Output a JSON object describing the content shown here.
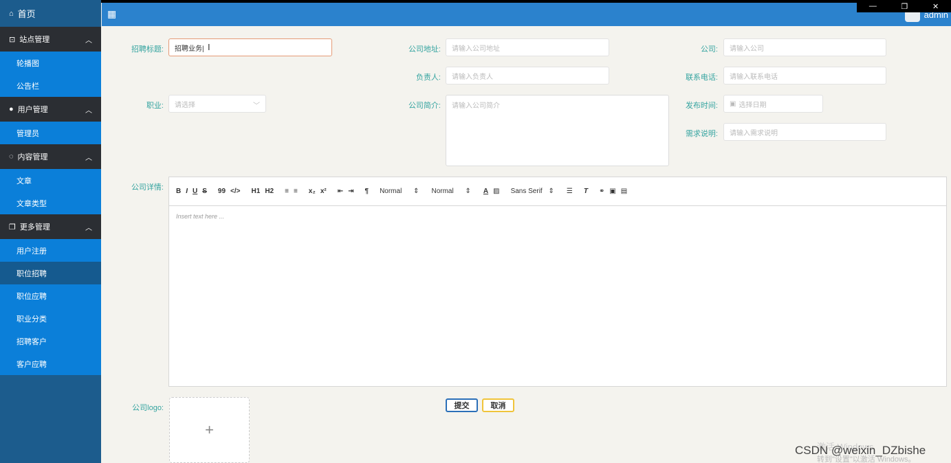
{
  "sidebar": {
    "home": "首页",
    "groups": [
      {
        "label": "站点管理",
        "items": [
          "轮播图",
          "公告栏"
        ]
      },
      {
        "label": "用户管理",
        "items": [
          "管理员"
        ]
      },
      {
        "label": "内容管理",
        "items": [
          "文章",
          "文章类型"
        ]
      },
      {
        "label": "更多管理",
        "items": [
          "用户注册",
          "职位招聘",
          "职位应聘",
          "职业分类",
          "招聘客户",
          "客户应聘"
        ]
      }
    ]
  },
  "topbar": {
    "user": "admin"
  },
  "form": {
    "title_label": "招聘标题:",
    "title_value": "招聘业务|",
    "address_label": "公司地址:",
    "address_placeholder": "请输入公司地址",
    "company_label": "公司:",
    "company_placeholder": "请输入公司",
    "owner_label": "负责人:",
    "owner_placeholder": "请输入负责人",
    "phone_label": "联系电话:",
    "phone_placeholder": "请输入联系电话",
    "job_label": "职业:",
    "job_placeholder": "请选择",
    "intro_label": "公司简介:",
    "intro_placeholder": "请输入公司简介",
    "date_label": "发布时间:",
    "date_placeholder": "选择日期",
    "need_label": "需求说明:",
    "need_placeholder": "请输入需求说明",
    "detail_label": "公司详情:",
    "logo_label": "公司logo:"
  },
  "editor": {
    "toolbar": [
      "B",
      "I",
      "U",
      "S",
      "99",
      "</>",
      "H1",
      "H2",
      "≡",
      "≡",
      "x₂",
      "x²",
      "⇤",
      "⇥",
      "¶"
    ],
    "size1": "Normal",
    "size2": "Normal",
    "font": "Sans Serif",
    "placeholder": "Insert text here ..."
  },
  "buttons": {
    "submit": "提交",
    "cancel": "取消"
  },
  "watermark": {
    "line1": "激活 Windows",
    "line2": "转到\"设置\"以激活 Windows。",
    "csdn": "CSDN @weixin_DZbishe"
  }
}
